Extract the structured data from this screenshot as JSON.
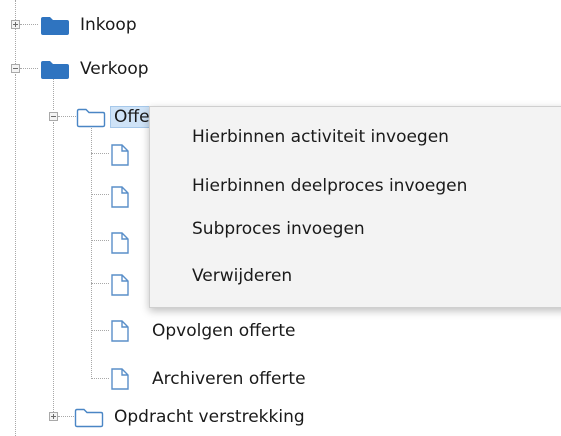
{
  "tree": {
    "nodes": [
      {
        "id": "inkoop",
        "label": "Inkoop",
        "type": "folder",
        "filled": true,
        "expander": "plus"
      },
      {
        "id": "verkoop",
        "label": "Verkoop",
        "type": "folder",
        "filled": true,
        "expander": "minus"
      },
      {
        "id": "offertebeheer",
        "label": "Offertebeheer",
        "type": "folder",
        "filled": false,
        "expander": "minus",
        "selected": true
      },
      {
        "id": "doc-1",
        "label": "",
        "type": "document"
      },
      {
        "id": "doc-2",
        "label": "",
        "type": "document"
      },
      {
        "id": "doc-3",
        "label": "",
        "type": "document"
      },
      {
        "id": "doc-4",
        "label": "",
        "type": "document"
      },
      {
        "id": "opvolgen-offerte",
        "label": "Opvolgen offerte",
        "type": "document"
      },
      {
        "id": "archiveren-offerte",
        "label": "Archiveren offerte",
        "type": "document"
      },
      {
        "id": "opdracht-verstrekking",
        "label": "Opdracht verstrekking",
        "type": "folder",
        "filled": false,
        "expander": "plus"
      }
    ]
  },
  "context_menu": {
    "items": [
      {
        "label": "Hierbinnen activiteit invoegen"
      },
      {
        "label": "Hierbinnen deelproces invoegen"
      },
      {
        "label": "Subproces invoegen"
      },
      {
        "label": "Verwijderen"
      }
    ]
  },
  "colors": {
    "folder_filled": "#2f74c0",
    "folder_outline": "#4a86c5",
    "document_outline": "#5a8fc9",
    "selection_bg": "#cfe3f7",
    "menu_bg": "#f3f3f3"
  },
  "icons": {
    "folder": "folder-icon",
    "document": "document-icon",
    "expand": "plus-icon",
    "collapse": "minus-icon"
  }
}
